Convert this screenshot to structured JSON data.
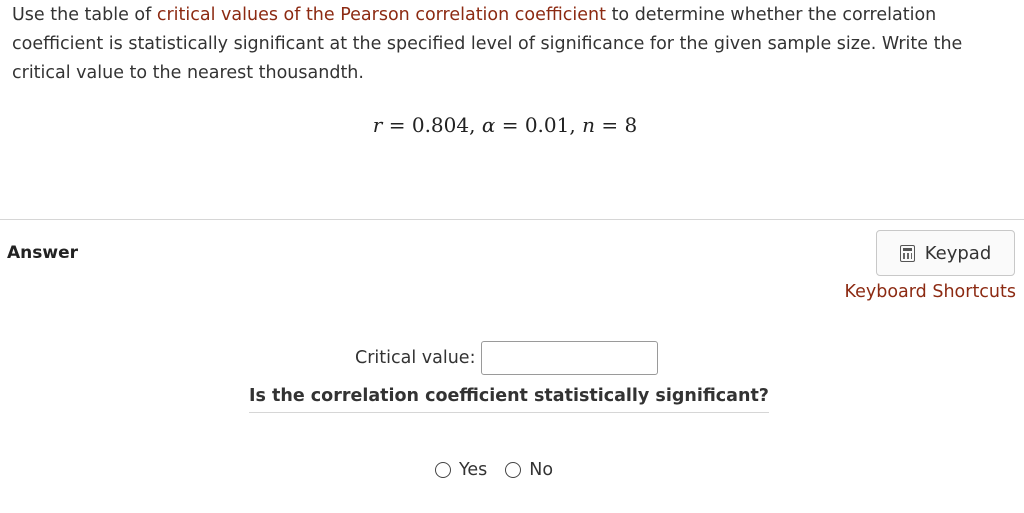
{
  "question": {
    "part1": "Use the table of ",
    "link": "critical values of the Pearson correlation coefficient",
    "part2": " to determine whether the correlation coefficient is statistically significant at the specified level of significance for the given sample size. Write the critical value to the nearest thousandth."
  },
  "formula": {
    "r_var": "r",
    "r_value": "0.804",
    "alpha_var": "α",
    "alpha_value": "0.01",
    "n_var": "n",
    "n_value": "8"
  },
  "answer": {
    "label": "Answer",
    "keypad_label": "Keypad",
    "keyboard_shortcuts": "Keyboard Shortcuts",
    "critical_value_label": "Critical value:",
    "critical_value_input": "",
    "significance_question": "Is the correlation coefficient statistically significant?",
    "options": [
      "Yes",
      "No"
    ]
  },
  "colors": {
    "link": "#8c2a12",
    "text": "#333333"
  },
  "icons": {
    "keypad": "calculator-icon",
    "option": "radio-button-icon"
  }
}
